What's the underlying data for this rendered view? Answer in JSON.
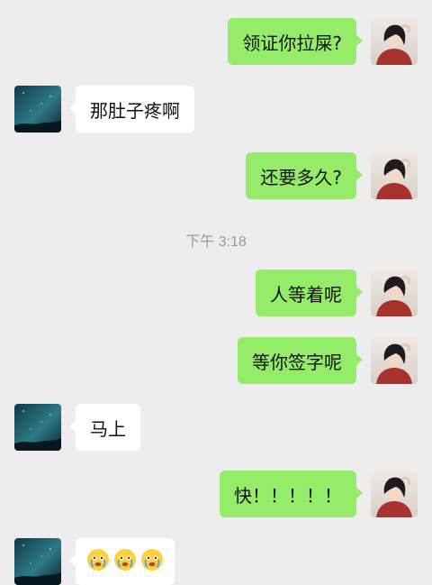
{
  "messages": [
    {
      "from": "self",
      "text": "领证你拉屎?"
    },
    {
      "from": "other",
      "text": "那肚子疼啊"
    },
    {
      "from": "self",
      "text": "还要多久?"
    },
    {
      "from": "self",
      "text": "人等着呢"
    },
    {
      "from": "self",
      "text": "等你签字呢"
    },
    {
      "from": "other",
      "text": "马上"
    },
    {
      "from": "self",
      "text": "快！！！！！"
    },
    {
      "from": "other",
      "emoji": [
        "crying-face",
        "crying-face",
        "crying-face"
      ]
    }
  ],
  "timestamp": "下午 3:18",
  "colors": {
    "background": "#ededed",
    "self_bubble": "#95ec69",
    "other_bubble": "#ffffff",
    "timestamp_text": "#9a9a9a"
  },
  "icons": {
    "self_avatar": "girl-red-shirt-avatar",
    "other_avatar": "night-sky-avatar"
  }
}
